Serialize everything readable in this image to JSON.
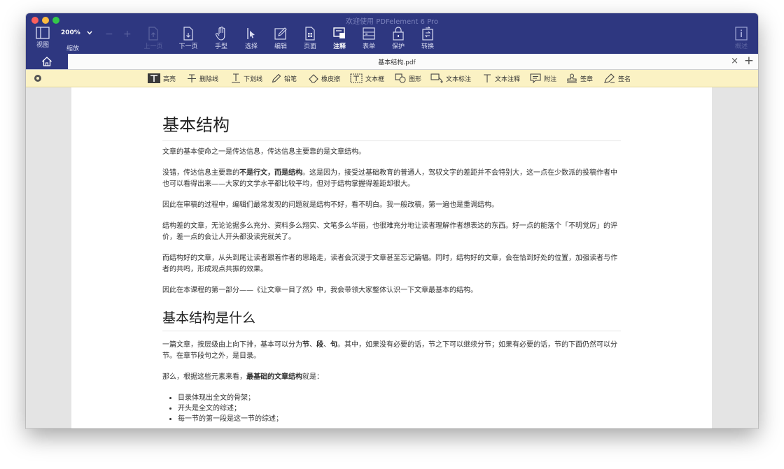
{
  "window": {
    "title": "欢迎使用 PDFelement 6 Pro"
  },
  "toolbar": {
    "view_label": "视图",
    "zoom_value": "200%",
    "zoom_label": "缩放",
    "zoom_out": "−",
    "zoom_in": "+",
    "prev_label": "上一页",
    "next_label": "下一页",
    "hand_label": "手型",
    "select_label": "选择",
    "edit_label": "编辑",
    "page_label": "页面",
    "comment_label": "注释",
    "form_label": "表单",
    "protect_label": "保护",
    "convert_label": "转换",
    "info_label": "概述"
  },
  "tabbar": {
    "file_name": "基本结构.pdf",
    "close": "×",
    "add": "+"
  },
  "annotations": {
    "highlight": "高亮",
    "strikethrough": "删除线",
    "underline": "下划线",
    "pencil": "铅笔",
    "eraser": "橡皮擦",
    "textbox": "文本框",
    "shape": "图形",
    "text_callout": "文本标注",
    "text_comment": "文本注释",
    "note": "附注",
    "stamp": "签章",
    "signature": "签名"
  },
  "document": {
    "h1": "基本结构",
    "p1": "文章的基本使命之一是传达信息，传达信息主要靠的是文章结构。",
    "p2_a": "没错，传达信息主要靠的",
    "p2_b": "不是行文，而是结构",
    "p2_c": "。这是因为，接受过基础教育的普通人，驾驭文字的差距并不会特别大，这一点在少数派的投稿作者中也可以看得出来——大家的文学水平都比较平均，但对于结构掌握得差距却很大。",
    "p3": "因此在审稿的过程中，编辑们最常发现的问题就是结构不好，看不明白。我一般改稿，第一遍也是重调结构。",
    "p4": "结构差的文章，无论论据多么充分、资料多么翔实、文笔多么华丽，也很难充分地让读者理解作者想表达的东西。好一点的能落个「不明觉厉」的评价，差一点的会让人开头都没读完就关了。",
    "p5": "而结构好的文章，从头到尾让读者跟着作者的思路走，读者会沉浸于文章甚至忘记篇幅。同时，结构好的文章，会在恰到好处的位置，加强读者与作者的共鸣，形成观点共振的效果。",
    "p6": "因此在本课程的第一部分——《让文章一目了然》中，我会带领大家整体认识一下文章最基本的结构。",
    "h2": "基本结构是什么",
    "p7_a": "一篇文章，按层级由上向下排，基本可以分为",
    "p7_b": "节",
    "p7_c": "、",
    "p7_d": "段",
    "p7_e": "、",
    "p7_f": "句",
    "p7_g": "。其中，如果没有必要的话，节之下可以继续分节；如果有必要的话，节的下面仍然可以分节。在章节段句之外，是目录。",
    "p8_a": "那么，根据这些元素来看，",
    "p8_b": "最基础的文章结构",
    "p8_c": "就是：",
    "list": [
      "目录体现出全文的骨架；",
      "开头是全文的综述；",
      "每一节的第一段是这一节的综述；"
    ]
  }
}
